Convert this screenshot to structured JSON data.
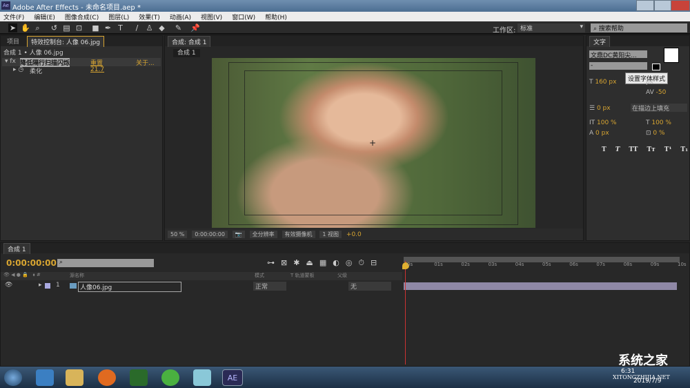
{
  "window": {
    "title": "Adobe After Effects - 未命名项目.aep *",
    "logo": "Ae"
  },
  "menu": [
    "文件(F)",
    "编辑(E)",
    "图像合成(C)",
    "图层(L)",
    "效果(T)",
    "动画(A)",
    "视图(V)",
    "窗口(W)",
    "帮助(H)"
  ],
  "toolbar": {
    "tools": [
      "selection-icon",
      "hand-icon",
      "zoom-icon",
      "rotate-icon",
      "camera-icon",
      "pan-behind-icon",
      "rectangle-icon",
      "pen-icon",
      "type-icon",
      "brush-icon",
      "clone-stamp-icon",
      "eraser-icon",
      "roto-brush-icon",
      "puppet-pin-icon"
    ],
    "workspace_label": "工作区:",
    "workspace_value": "标准",
    "search_placeholder": "搜索帮助"
  },
  "left_panel": {
    "tabs": [
      "项目",
      "特效控制台: 人像 06.jpg"
    ],
    "breadcrumb": "合成 1 • 人像 06.jpg",
    "effect_name": "降低隔行扫描闪烁",
    "reset": "重置",
    "about": "关于...",
    "param_name": "柔化",
    "param_value": "21.7"
  },
  "viewer": {
    "tab": "合成: 合成 1",
    "subtab": "合成 1",
    "zoom": "50 %",
    "timecode": "0:00:00:00",
    "resolution": "全分辨率",
    "camera": "有效摄像机",
    "views": "1 视图",
    "exposure": "+0.0"
  },
  "text_panel": {
    "tab": "文字",
    "font": "文鼎DC黄阳尖...",
    "style": "-",
    "tooltip": "设置字体样式",
    "size": "160 px",
    "leading": "px",
    "tracking": "-50",
    "stroke_width": "0 px",
    "stroke_mode": "在描边上填充",
    "vscale": "100 %",
    "hscale": "100 %",
    "baseline": "0 px",
    "tsume": "0 %",
    "styles": [
      "T",
      "T",
      "TT",
      "Tт",
      "T¹",
      "T₁"
    ],
    "fill_color": "#ffffff",
    "stroke_color": "#000000"
  },
  "timeline": {
    "tab": "合成 1",
    "timecode": "0:00:00:00",
    "columns": {
      "source_name": "源名称",
      "mode": "模式",
      "trkmat": "T  轨道蒙板",
      "parent": "父级"
    },
    "layers": [
      {
        "index": "1",
        "name": "人像06.jpg",
        "mode": "正常",
        "parent": "无",
        "label_color": "#a9a9e0"
      }
    ],
    "ruler": [
      "0s",
      "01s",
      "02s",
      "03s",
      "04s",
      "05s",
      "06s",
      "07s",
      "08s",
      "09s",
      "10s"
    ],
    "bar_color": "#8f88a6"
  },
  "taskbar": {
    "watermark": "系统之家",
    "watermark_url": "XITONGZHIJIA.NET",
    "clock_time": "6:31",
    "clock_date": "2019/7/9",
    "apps": [
      "start-orb-icon",
      "media-center-icon",
      "explorer-icon",
      "firefox-icon",
      "media-player-icon",
      "360-browser-icon",
      "app-icon",
      "after-effects-icon"
    ],
    "ae_label": "AE"
  }
}
